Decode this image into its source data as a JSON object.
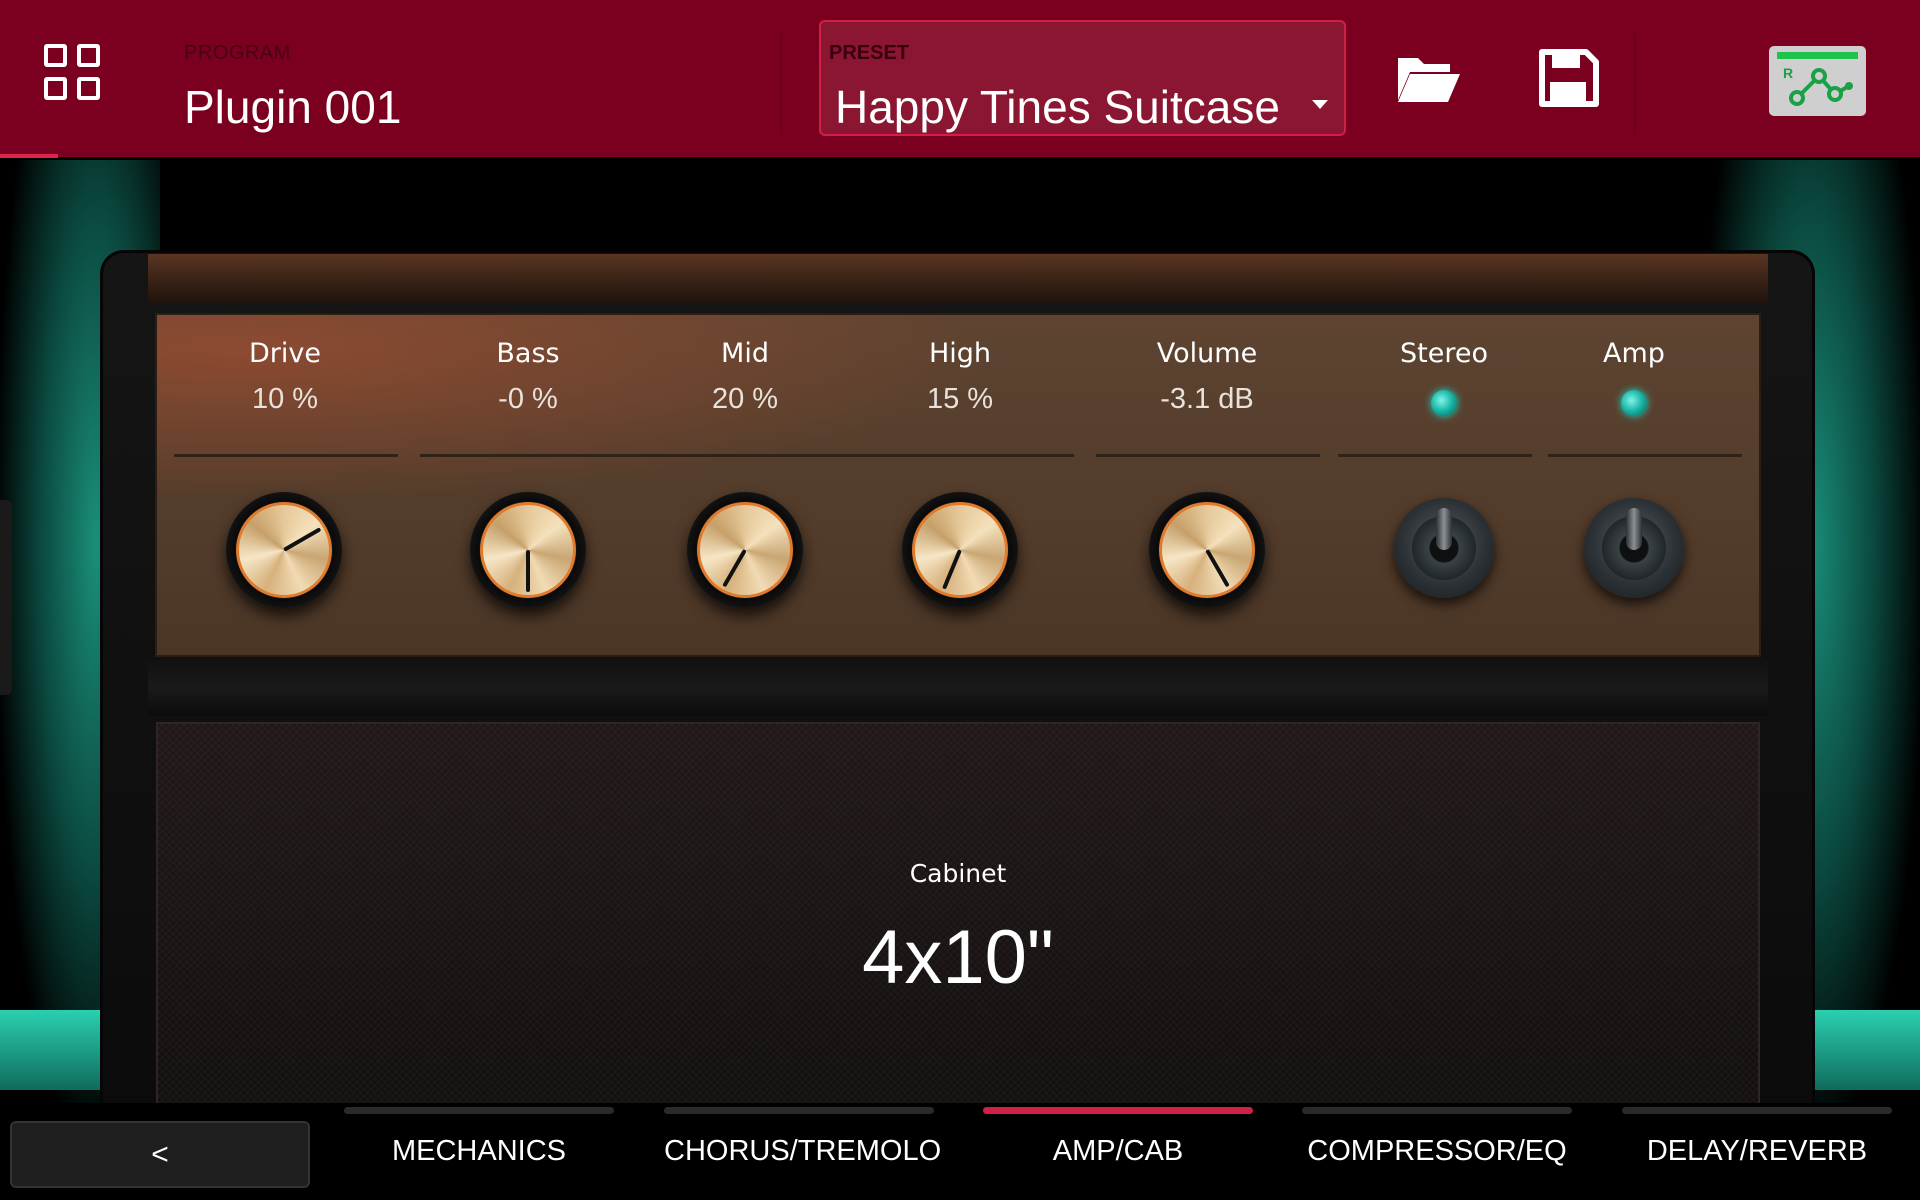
{
  "header": {
    "program_caption": "PROGRAM",
    "program_name": "Plugin 001",
    "preset_caption": "PRESET",
    "preset_name": "Happy Tines Suitcase",
    "icons": [
      "grid-icon",
      "folder-open-icon",
      "save-icon",
      "routing-icon"
    ],
    "colors": {
      "header_bg": "#7b0020",
      "accent": "#d11f45",
      "routing_green": "#1ec24d"
    }
  },
  "amp": {
    "controls": [
      {
        "label": "Drive",
        "value": "10 %",
        "level": 0.1
      },
      {
        "label": "Bass",
        "value": "-0 %",
        "level": 0.5
      },
      {
        "label": "Mid",
        "value": "20 %",
        "level": 0.6
      },
      {
        "label": "High",
        "value": "15 %",
        "level": 0.575
      },
      {
        "label": "Volume",
        "value": "-3.1 dB",
        "level": 0.4
      }
    ],
    "switches": [
      {
        "label": "Stereo",
        "on": true
      },
      {
        "label": "Amp",
        "on": true
      }
    ],
    "cabinet_label": "Cabinet",
    "cabinet_value": "4x10\""
  },
  "tabs": {
    "back_label": "<",
    "items": [
      {
        "label": "MECHANICS",
        "active": false
      },
      {
        "label": "CHORUS/TREMOLO",
        "active": false
      },
      {
        "label": "AMP/CAB",
        "active": true
      },
      {
        "label": "COMPRESSOR/EQ",
        "active": false
      },
      {
        "label": "DELAY/REVERB",
        "active": false
      }
    ]
  }
}
